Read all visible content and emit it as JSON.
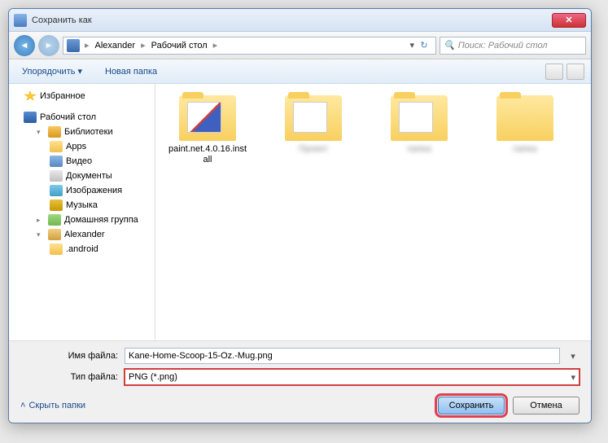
{
  "title": "Сохранить как",
  "breadcrumb": {
    "user": "Alexander",
    "location": "Рабочий стол"
  },
  "search_placeholder": "Поиск: Рабочий стол",
  "toolbar": {
    "organize": "Упорядочить",
    "new_folder": "Новая папка"
  },
  "sidebar": {
    "favorites": "Избранное",
    "desktop": "Рабочий стол",
    "libraries": "Библиотеки",
    "apps": "Apps",
    "video": "Видео",
    "documents": "Документы",
    "images": "Изображения",
    "music": "Музыка",
    "homegroup": "Домашняя группа",
    "user": "Alexander",
    "android": ".android"
  },
  "files": [
    {
      "label": "paint.net.4.0.16.install"
    },
    {
      "label": "Проект"
    },
    {
      "label": "папка"
    },
    {
      "label": "папка"
    }
  ],
  "fields": {
    "filename_label": "Имя файла:",
    "filename_value": "Kane-Home-Scoop-15-Oz.-Mug.png",
    "filetype_label": "Тип файла:",
    "filetype_value": "PNG (*.png)"
  },
  "buttons": {
    "hide_folders": "Скрыть папки",
    "save": "Сохранить",
    "cancel": "Отмена"
  }
}
